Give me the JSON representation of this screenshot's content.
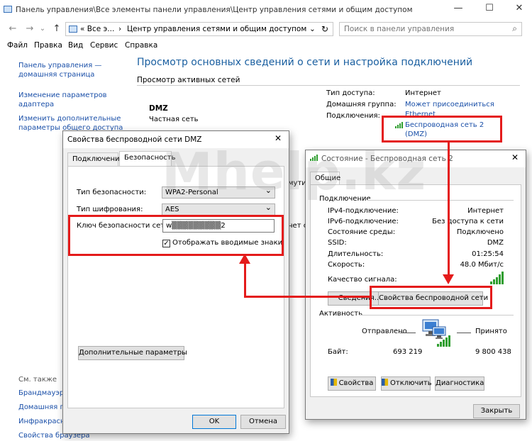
{
  "window": {
    "title": "Панель управления\\Все элементы панели управления\\Центр управления сетями и общим доступом",
    "minimize": "—",
    "maximize": "☐",
    "close": "✕"
  },
  "address": {
    "back": "←",
    "forward": "→",
    "up": "↑",
    "crumb1": "«  Все э...",
    "sep": "›",
    "crumb2": "Центр управления сетями и общим доступом",
    "dropdown": "⌄",
    "refresh": "↻",
    "search_placeholder": "Поиск в панели управления",
    "search_icon": "⌕"
  },
  "menu": [
    "Файл",
    "Правка",
    "Вид",
    "Сервис",
    "Справка"
  ],
  "left_panel": {
    "home1": "Панель управления —",
    "home2": "домашняя страница",
    "adapter1": "Изменение параметров",
    "adapter2": "адаптера",
    "sharing1": "Изменить дополнительные",
    "sharing2": "параметры общего доступа",
    "see_also": "См. также",
    "items": [
      "Брандмауэр Т",
      "Домашняя гр",
      "Инфракрасн",
      "Свойства браузера"
    ]
  },
  "main": {
    "heading": "Просмотр основных сведений о сети и настройка подключений",
    "active_networks": "Просмотр активных сетей",
    "network_name": "DMZ",
    "network_type": "Частная сеть",
    "access_type_label": "Тип доступа:",
    "access_type_value": "Интернет",
    "homegroup_label": "Домашняя группа:",
    "homegroup_value": "Может присоединиться",
    "connections_label": "Подключения:",
    "conn_ethernet": "Ethernet",
    "conn_wifi1": "Беспроводная сеть 2",
    "conn_wifi2": "(DMZ)",
    "partial1": "мути",
    "partial2": "нет с"
  },
  "dialog_security": {
    "title": "Свойства беспроводной сети DMZ",
    "close": "✕",
    "tab_connection": "Подключение",
    "tab_security": "Безопасность",
    "security_type_label": "Тип безопасности:",
    "security_type_value": "WPA2-Personal",
    "encryption_label": "Тип шифрования:",
    "encryption_value": "AES",
    "key_label": "Ключ безопасности сети",
    "key_value": "w▒▒▒▒▒▒▒▒▒2",
    "show_chars_label": "Отображать вводимые знаки",
    "show_chars_checked": "✓",
    "advanced_button": "Дополнительные параметры",
    "ok_button": "OK",
    "cancel_button": "Отмена"
  },
  "dialog_status": {
    "title": "Состояние - Беспроводная сеть 2",
    "close": "✕",
    "tab_general": "Общие",
    "section_connection": "Подключение",
    "rows": [
      {
        "label": "IPv4-подключение:",
        "value": "Интернет"
      },
      {
        "label": "IPv6-подключение:",
        "value": "Без доступа к сети"
      },
      {
        "label": "Состояние среды:",
        "value": "Подключено"
      },
      {
        "label": "SSID:",
        "value": "DMZ"
      },
      {
        "label": "Длительность:",
        "value": "01:25:54"
      },
      {
        "label": "Скорость:",
        "value": "48.0 Мбит/с"
      }
    ],
    "signal_label": "Качество сигнала:",
    "signal_bars": 5,
    "details_button": "Сведения...",
    "wireless_props_button": "Свойства беспроводной сети",
    "section_activity": "Активность",
    "sent_label": "Отправлено",
    "received_label": "Принято",
    "bytes_label": "Байт:",
    "bytes_sent": "693 219",
    "bytes_received": "9 800 438",
    "properties_button": "Свойства",
    "disable_button": "Отключить",
    "diagnose_button": "Диагностика",
    "close_button": "Закрыть"
  },
  "watermark": "Mhelp.kz",
  "colors": {
    "accent_red": "#e41b1b",
    "link_blue": "#1a4fa8",
    "heading_blue": "#1a5fa0",
    "signal_green": "#2f9e2f"
  }
}
